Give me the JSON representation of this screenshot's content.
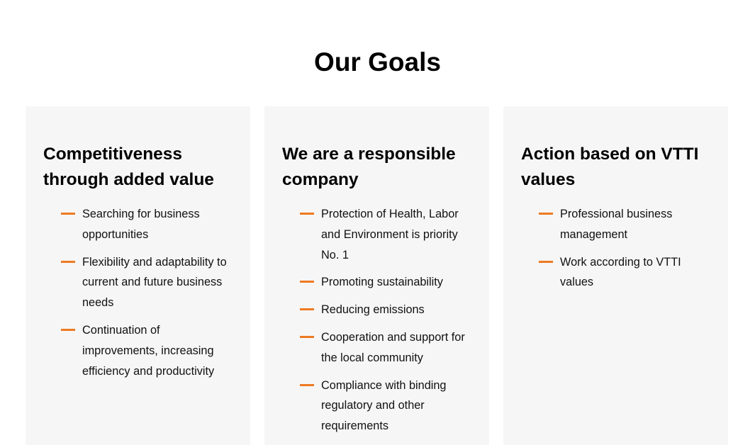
{
  "section": {
    "title": "Our Goals"
  },
  "colors": {
    "accent": "#ee7a22",
    "card_background": "#f6f6f6"
  },
  "icons": {
    "bullet": "dash-icon"
  },
  "cards": [
    {
      "title": "Competitiveness through added value",
      "items": [
        "Searching for business opportunities",
        "Flexibility and adaptability to current and future business needs",
        "Continuation of improvements, increasing efficiency and productivity"
      ]
    },
    {
      "title": "We are a responsible company",
      "items": [
        "Protection of Health, Labor and Environment is priority No. 1",
        "Promoting sustainability",
        "Reducing emissions",
        "Cooperation and support for the local community",
        "Compliance with binding regulatory and other requirements"
      ]
    },
    {
      "title": "Action based on VTTI values",
      "items": [
        "Professional business management",
        "Work according to VTTI values"
      ]
    }
  ]
}
